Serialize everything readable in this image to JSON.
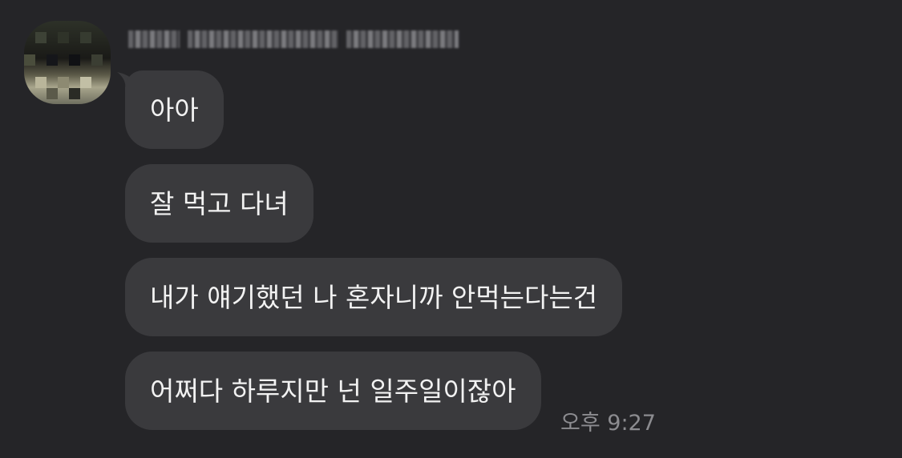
{
  "conversation": {
    "sender_name": "",
    "messages": [
      {
        "text": "아아"
      },
      {
        "text": "잘 먹고 다녀"
      },
      {
        "text": "내가 얘기했던 나 혼자니까 안먹는다는건"
      },
      {
        "text": "어쩌다 하루지만 넌 일주일이잖아"
      }
    ],
    "last_timestamp": "오후 9:27"
  },
  "colors": {
    "background": "#252528",
    "bubble": "#3a3a3d",
    "text": "#f2f2f2",
    "timestamp": "#8c8c90"
  },
  "icons": {
    "avatar": "profile-photo-pixelated"
  }
}
